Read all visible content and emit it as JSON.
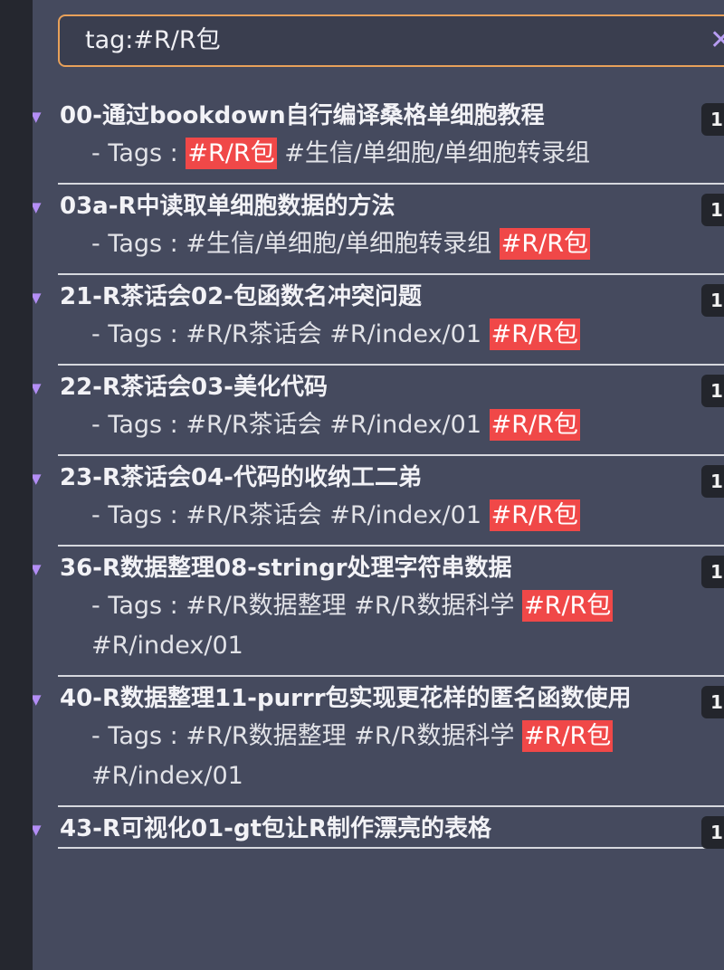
{
  "search": {
    "query": "tag:#R/R包",
    "clear_glyph": "✕"
  },
  "colors": {
    "accent_border": "#e8a15a",
    "highlight": "#f04848",
    "arrow": "#b48ef6"
  },
  "results": [
    {
      "title": "00-通过bookdown自行编译桑格单细胞教程",
      "count": "1",
      "tags_prefix": "- Tags :",
      "tags": [
        {
          "text": "#R/R包",
          "hl": true
        },
        {
          "text": "#生信/单细胞/单细胞转录组",
          "hl": false
        }
      ]
    },
    {
      "title": "03a-R中读取单细胞数据的方法",
      "count": "1",
      "tags_prefix": "- Tags :",
      "tags": [
        {
          "text": "#生信/单细胞/单细胞转录组",
          "hl": false
        },
        {
          "text": "#R/R包",
          "hl": true
        }
      ]
    },
    {
      "title": "21-R茶话会02-包函数名冲突问题",
      "count": "1",
      "tags_prefix": "- Tags :",
      "tags": [
        {
          "text": "#R/R茶话会 ",
          "hl": false
        },
        {
          "text": "#R/index/01",
          "hl": false
        },
        {
          "text": "#R/R包",
          "hl": true
        }
      ]
    },
    {
      "title": "22-R茶话会03-美化代码",
      "count": "1",
      "tags_prefix": "- Tags :",
      "tags": [
        {
          "text": "#R/R茶话会 ",
          "hl": false
        },
        {
          "text": "#R/index/01",
          "hl": false
        },
        {
          "text": "#R/R包",
          "hl": true
        }
      ]
    },
    {
      "title": "23-R茶话会04-代码的收纳工二弟",
      "count": "1",
      "tags_prefix": "- Tags :",
      "tags": [
        {
          "text": "#R/R茶话会 ",
          "hl": false
        },
        {
          "text": "#R/index/01",
          "hl": false
        },
        {
          "text": "#R/R包",
          "hl": true
        }
      ]
    },
    {
      "title": "36-R数据整理08-stringr处理字符串数据",
      "count": "1",
      "tags_prefix": "- Tags :",
      "tags": [
        {
          "text": "#R/R数据整理",
          "hl": false
        },
        {
          "text": "#R/R数据科学",
          "hl": false
        },
        {
          "text": "#R/R包",
          "hl": true
        },
        {
          "text": "#R/index/01",
          "hl": false
        }
      ]
    },
    {
      "title": "40-R数据整理11-purrr包实现更花样的匿名函数使用",
      "count": "1",
      "tags_prefix": "- Tags : ",
      "tags": [
        {
          "text": "#R/R数据整理",
          "hl": false
        },
        {
          "text": "#R/R数据科学",
          "hl": false
        },
        {
          "text": "#R/R包",
          "hl": true
        },
        {
          "text": "#R/index/01",
          "hl": false
        }
      ]
    },
    {
      "title": "43-R可视化01-gt包让R制作漂亮的表格",
      "count": "1",
      "tags_prefix": "",
      "tags": []
    }
  ]
}
